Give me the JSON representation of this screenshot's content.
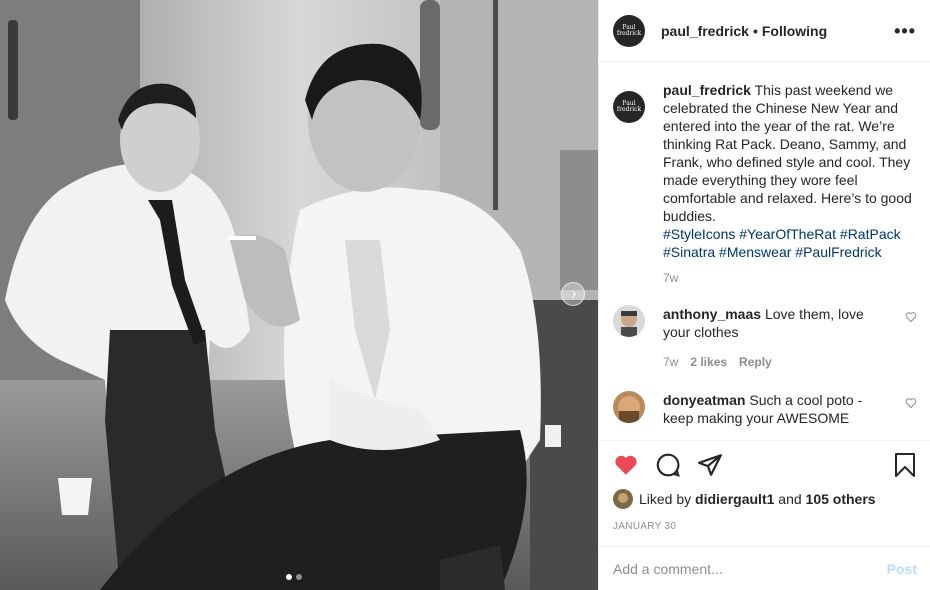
{
  "post": {
    "author": {
      "username": "paul_fredrick",
      "avatar_text": "Paul\nfredrick"
    },
    "follow_status": "Following",
    "separator": "•",
    "caption": {
      "text": "This past weekend we celebrated the Chinese New Year and entered into the year of the rat. We’re thinking Rat Pack. Deano, Sammy, and Frank, who defined style and cool. They made everything they wore feel comfortable and relaxed. Here’s to good buddies.",
      "hashtags": "#StyleIcons #YearOfTheRat #RatPack #Sinatra #Menswear #PaulFredrick",
      "time": "7w"
    },
    "comments": [
      {
        "username": "anthony_maas",
        "text": "Love them, love your clothes",
        "time": "7w",
        "likes": "2 likes",
        "reply": "Reply"
      },
      {
        "username": "donyeatman",
        "text": "Such a cool poto - keep making your AWESOME",
        "time": "",
        "likes": "",
        "reply": ""
      }
    ],
    "liked_by": {
      "prefix": "Liked by",
      "user": "didiergault1",
      "conj": "and",
      "others": "105 others"
    },
    "date": "JANUARY 30",
    "add_comment": {
      "placeholder": "Add a comment...",
      "post_label": "Post"
    },
    "carousel": {
      "current": 1,
      "total": 2,
      "next_icon": "chevron-right-icon"
    }
  },
  "colors": {
    "like_red": "#ed4956",
    "hashtag": "#00376b",
    "muted": "#8e8e8e",
    "post_disabled": "#b2dffc"
  }
}
